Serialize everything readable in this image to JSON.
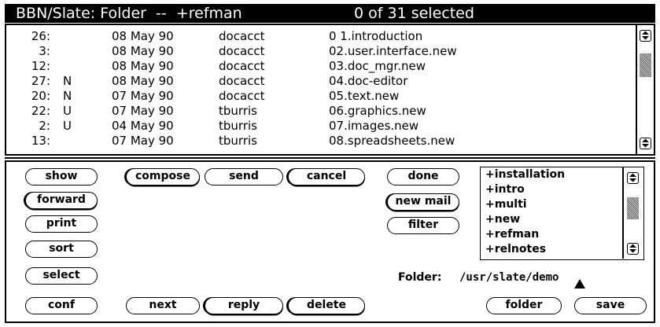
{
  "window": {
    "title": "BBN/Slate: Folder  --  +refman",
    "selection_status": "0 of 31 selected",
    "title_bar_color": "#000000"
  },
  "messages": [
    {
      "num": "26:",
      "flag": "",
      "date": "08 May 90",
      "owner": "docacct",
      "name": "0 1.introduction"
    },
    {
      "num": "3:",
      "flag": "",
      "date": "08 May 90",
      "owner": "docacct",
      "name": "02.user.interface.new"
    },
    {
      "num": "12:",
      "flag": "",
      "date": "08 May 90",
      "owner": "docacct",
      "name": "03.doc_mgr.new"
    },
    {
      "num": "27:",
      "flag": "N",
      "date": "08 May 90",
      "owner": "docacct",
      "name": "04.doc-editor"
    },
    {
      "num": "20:",
      "flag": "N",
      "date": "07 May 90",
      "owner": "docacct",
      "name": "05.text.new"
    },
    {
      "num": "22:",
      "flag": "U",
      "date": "07 May 90",
      "owner": "tburris",
      "name": "06.graphics.new"
    },
    {
      "num": "2:",
      "flag": "U",
      "date": "04 May 90",
      "owner": "tburris",
      "name": "07.images.new"
    },
    {
      "num": "13:",
      "flag": "",
      "date": "07 May 90",
      "owner": "tburris",
      "name": "08.spreadsheets.new"
    }
  ],
  "buttons": {
    "show": "show",
    "forward": "forward",
    "print": "print",
    "sort": "sort",
    "select": "select",
    "conf": "conf",
    "compose": "compose",
    "send": "send",
    "cancel": "cancel",
    "done": "done",
    "new_mail": "new mail",
    "filter": "filter",
    "next": "next",
    "reply": "reply",
    "delete": "delete",
    "folder": "folder",
    "save": "save"
  },
  "folder_list": [
    "+installation",
    "+intro",
    "+multi",
    "+new",
    "+refman",
    "+relnotes"
  ],
  "folder_field": {
    "label": "Folder:",
    "value": "/usr/slate/demo"
  },
  "icons": {
    "scroll_up_down": "up-down-arrow-icon",
    "scroll_down": "down-arrow-icon",
    "pointer": "mouse-pointer-icon"
  }
}
